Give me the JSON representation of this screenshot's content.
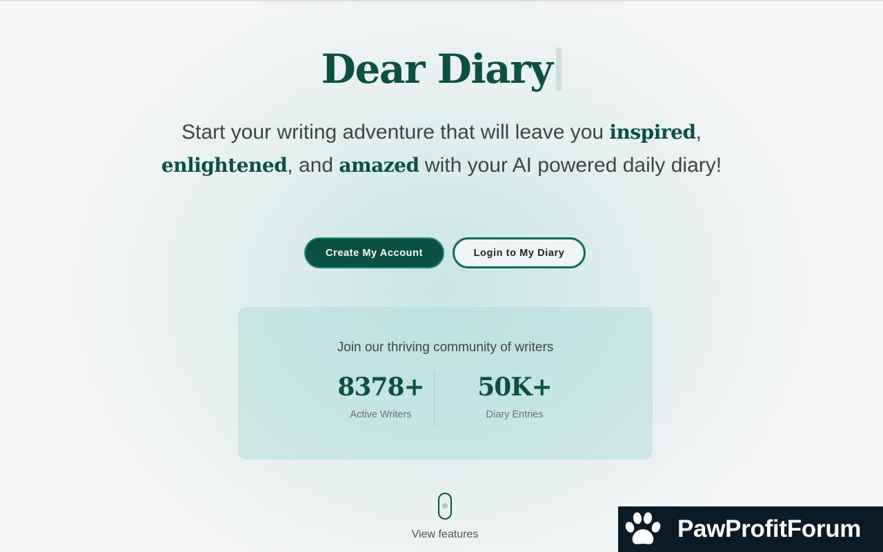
{
  "hero": {
    "title": "Dear Diary",
    "subtitle_part1": "Start your writing adventure that will leave you ",
    "highlight_1": "inspired",
    "subtitle_part2": ",",
    "highlight_2": "enlightened",
    "subtitle_part3": ", and ",
    "highlight_3": "amazed",
    "subtitle_part4": " with your AI powered daily diary!"
  },
  "actions": {
    "create_account_label": "Create My Account",
    "login_label": "Login to My Diary"
  },
  "stats": {
    "heading": "Join our thriving community of writers",
    "items": [
      {
        "value": "8378+",
        "label": "Active Writers"
      },
      {
        "value": "50K+",
        "label": "Diary Entries"
      }
    ]
  },
  "scroll_hint": {
    "label": "View features"
  },
  "watermark": {
    "text": "PawProfitForum"
  },
  "colors": {
    "brand": "#0b5142",
    "accent_border": "#1f8b7a",
    "text": "#3d4544",
    "watermark_bg": "#0a1a26"
  }
}
